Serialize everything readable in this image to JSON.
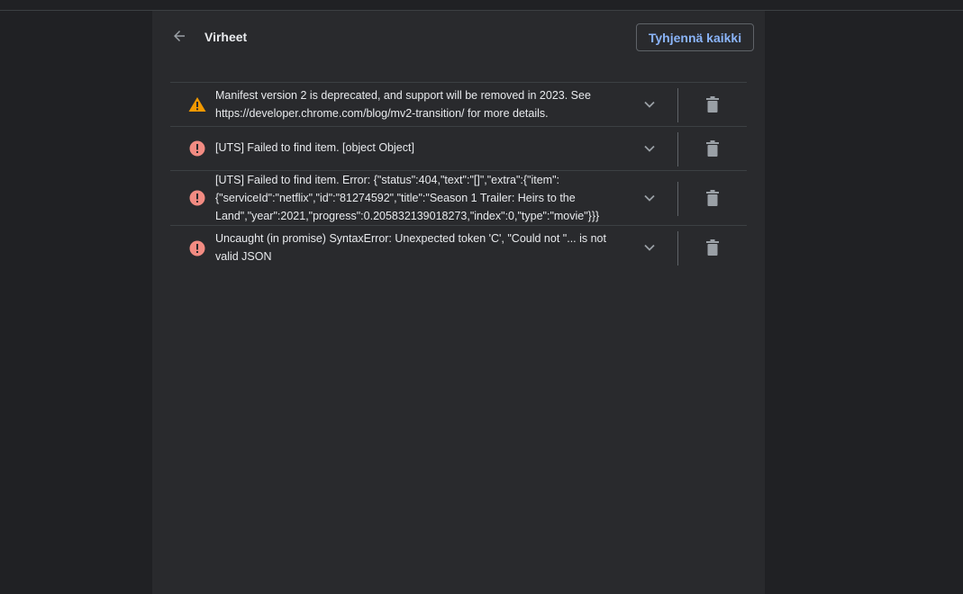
{
  "header": {
    "title": "Virheet",
    "clear_all_label": "Tyhjennä kaikki"
  },
  "colors": {
    "warning": "#f29900",
    "error": "#f28b82",
    "accent": "#8ab4f8"
  },
  "errors": [
    {
      "severity": "warning",
      "icon": "warning-icon",
      "message": "Manifest version 2 is deprecated, and support will be removed in 2023. See https://developer.chrome.com/blog/mv2-transition/ for more details."
    },
    {
      "severity": "error",
      "icon": "error-icon",
      "message": "[UTS] Failed to find item. [object Object]"
    },
    {
      "severity": "error",
      "icon": "error-icon",
      "message": "[UTS] Failed to find item. Error: {\"status\":404,\"text\":\"[]\",\"extra\":{\"item\":{\"serviceId\":\"netflix\",\"id\":\"81274592\",\"title\":\"Season 1 Trailer: Heirs to the Land\",\"year\":2021,\"progress\":0.205832139018273,\"index\":0,\"type\":\"movie\"}}}"
    },
    {
      "severity": "error",
      "icon": "error-icon",
      "message": "Uncaught (in promise) SyntaxError: Unexpected token 'C', \"Could not \"... is not valid JSON"
    }
  ]
}
